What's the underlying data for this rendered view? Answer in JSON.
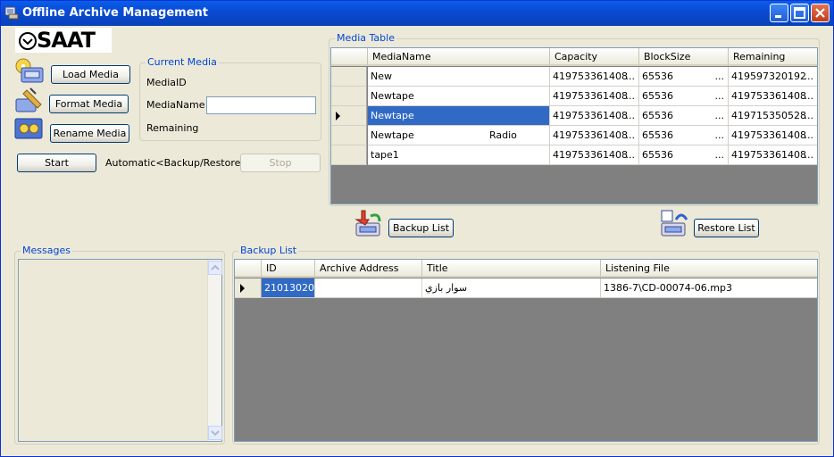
{
  "window": {
    "title": "Offline Archive Management"
  },
  "logo": {
    "text": "SAAT"
  },
  "buttons": {
    "load_media": "Load  Media",
    "format_media": "Format Media",
    "rename_media": "Rename Media",
    "start": "Start",
    "stop": "Stop",
    "backup_list": "Backup List",
    "restore_list": "Restore List"
  },
  "current_media": {
    "legend": "Current Media",
    "media_id_label": "MediaID",
    "media_name_label": "MediaName",
    "media_name_value": "",
    "remaining_label": "Remaining"
  },
  "automatic_label": "Automatic<Backup/Restore>",
  "media_table": {
    "legend": "Media Table",
    "columns": [
      "MediaName",
      "Capacity",
      "BlockSize",
      "Remaining"
    ],
    "rows": [
      {
        "name": "New",
        "extra": "",
        "capacity": "419753361408",
        "blocksize": "65536",
        "remaining": "419597320192",
        "selected": false,
        "current": false
      },
      {
        "name": "Newtape",
        "extra": "",
        "capacity": "419753361408",
        "blocksize": "65536",
        "remaining": "419753361408",
        "selected": false,
        "current": false
      },
      {
        "name": "Newtape",
        "extra": "",
        "capacity": "419753361408",
        "blocksize": "65536",
        "remaining": "419715350528",
        "selected": true,
        "current": true
      },
      {
        "name": "Newtape",
        "extra": "Radio",
        "capacity": "419753361408",
        "blocksize": "65536",
        "remaining": "419753361408",
        "selected": false,
        "current": false
      },
      {
        "name": "tape1",
        "extra": "",
        "capacity": "419753361408",
        "blocksize": "65536",
        "remaining": "419753361408",
        "selected": false,
        "current": false
      }
    ],
    "ellipsis": "..."
  },
  "messages": {
    "legend": "Messages"
  },
  "backup_list": {
    "legend": "Backup List",
    "columns": [
      "ID",
      "Archive Address",
      "Title",
      "Listening File"
    ],
    "rows": [
      {
        "id": "21013020",
        "archive_address": "",
        "title": "سوار بازي",
        "listening_file": "1386-7\\CD-00074-06.mp3"
      }
    ]
  },
  "colors": {
    "title_bar": "#0A4BD6",
    "selection": "#316AC5",
    "legend": "#0046D5",
    "grid_background": "#808080"
  },
  "icons": [
    "app-icon",
    "minimize-icon",
    "maximize-icon",
    "close-icon",
    "clock-logo-icon",
    "load-media-icon",
    "format-media-icon",
    "rename-media-icon",
    "backup-list-icon",
    "restore-list-icon",
    "row-pointer-icon",
    "scroll-up-icon",
    "scroll-down-icon"
  ]
}
